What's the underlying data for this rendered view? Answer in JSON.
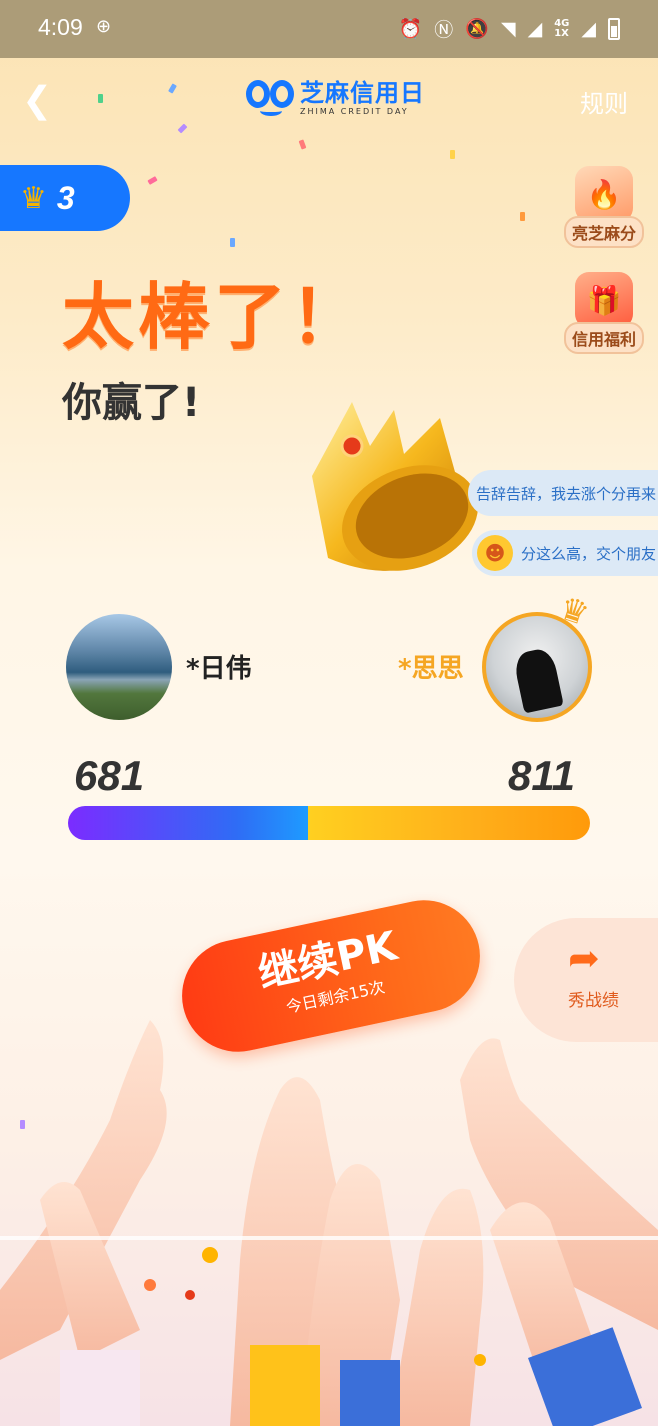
{
  "status_bar": {
    "time": "4:09",
    "network": "4G\n1X"
  },
  "nav": {
    "back_icon": "chevron-left-icon",
    "logo_title": "芝麻信用日",
    "logo_subtitle": "ZHIMA CREDIT DAY",
    "rules_label": "规则"
  },
  "rank_badge": {
    "icon": "crown-icon",
    "value": "3"
  },
  "side_buttons": [
    {
      "label": "亮芝麻分",
      "icon": "flame-icon"
    },
    {
      "label": "信用福利",
      "icon": "gift-icon"
    }
  ],
  "result": {
    "headline": "太棒了！",
    "subhead": "你赢了!"
  },
  "danmu": [
    "告辞告辞，我去涨个分再来",
    "分这么高，交个朋友"
  ],
  "players": {
    "left": {
      "name": "*日伟",
      "score": "681"
    },
    "right": {
      "name": "*思思",
      "score": "811"
    }
  },
  "pk_bar": {
    "left_share": 0.46
  },
  "actions": {
    "continue_label": "继续PK",
    "continue_sub": "今日剩余15次",
    "share_label": "秀战绩"
  },
  "colors": {
    "brand_blue": "#1677ff",
    "accent_orange": "#ff6a14",
    "gold": "#f5a623"
  }
}
